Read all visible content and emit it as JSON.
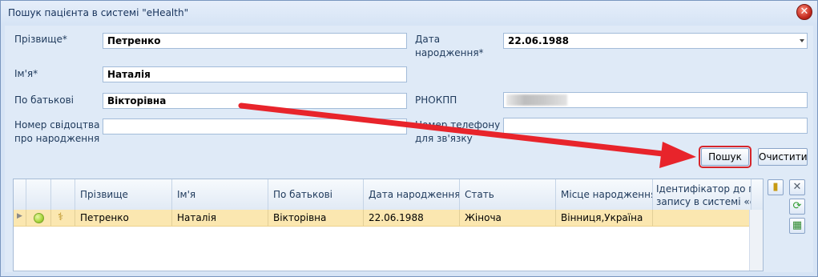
{
  "window": {
    "title": "Пошук пацієнта в системі \"eHealth\""
  },
  "form": {
    "last_name": {
      "label": "Прізвище*",
      "value": "Петренко"
    },
    "first_name": {
      "label": "Ім'я*",
      "value": "Наталія"
    },
    "patronymic": {
      "label": "По батькові",
      "value": "Вікторівна"
    },
    "birth_cert": {
      "label_line1": "Номер свідоцтва",
      "label_line2": "про народження",
      "value": ""
    },
    "birth_date": {
      "label_line1": "Дата",
      "label_line2": "народження*",
      "value": "22.06.1988"
    },
    "rnokpp": {
      "label": "РНОКПП",
      "value": ""
    },
    "phone": {
      "label_line1": "Номер телефону",
      "label_line2": "для зв'язку",
      "value": ""
    }
  },
  "buttons": {
    "search": "Пошук",
    "clear": "Очистити"
  },
  "grid": {
    "columns": [
      "Прізвище",
      "Ім'я",
      "По батькові",
      "Дата народження",
      "Стать",
      "Місце народження"
    ],
    "id_column_line1": "Ідентифікатор до пр",
    "id_column_line2": "запису в системі «еН",
    "rows": [
      {
        "last_name": "Петренко",
        "first_name": "Наталія",
        "patronymic": "Вікторівна",
        "birth_date": "22.06.1988",
        "gender": "Жіноча",
        "birth_place": "Вінниця,Україна",
        "status_color": "#a8d63c"
      }
    ]
  },
  "icons": {
    "close": "close-icon",
    "side_tools": [
      "book-icon",
      "tools-icon",
      "refresh-icon",
      "calendar-icon"
    ]
  },
  "colors": {
    "annotation_arrow": "#e8242b",
    "selected_row": "#fbe7b0"
  }
}
